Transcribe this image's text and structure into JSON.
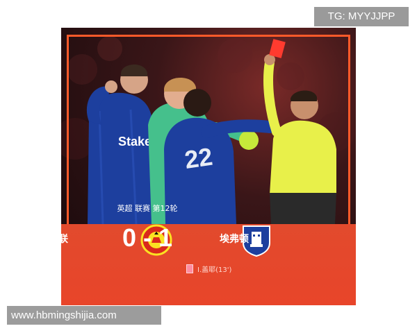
{
  "watermarks": {
    "top": "TG: MYYJJPP",
    "bottom": "www.hbmingshijia.com"
  },
  "match": {
    "competition": "英超 联赛 第12轮",
    "home_team": "曼联",
    "away_team": "埃弗顿",
    "score": "0 - 1",
    "home_crest_text": "MANCHESTER UNITED",
    "away_crest_text": "Everton",
    "event": "I.盖耶(13')"
  },
  "photo": {
    "shirt_sponsor": "Stake",
    "shirt_number": "22"
  },
  "colors": {
    "accent": "#e8452a",
    "everton_blue": "#1d3f9e",
    "keeper_green": "#45c08c",
    "referee_yellow": "#e8f04a",
    "red_card": "#ff3b2f"
  }
}
